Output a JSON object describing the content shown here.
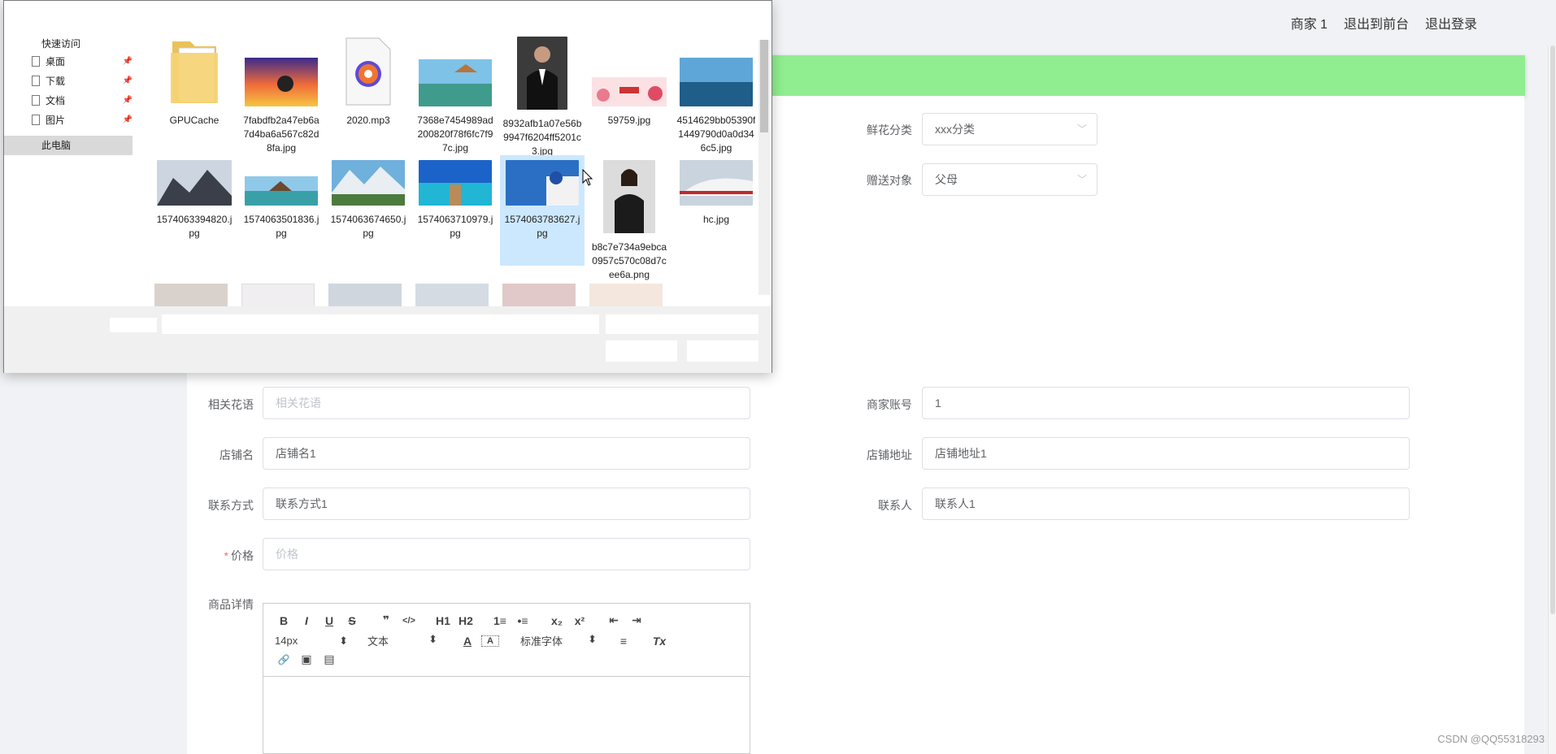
{
  "header": {
    "merchant": "商家 1",
    "to_front": "退出到前台",
    "logout": "退出登录"
  },
  "form": {
    "category": {
      "label": "鲜花分类",
      "value": "xxx分类"
    },
    "recipient": {
      "label": "赠送对象",
      "value": "父母"
    },
    "flower_language": {
      "label": "相关花语",
      "placeholder": "相关花语"
    },
    "merchant_account": {
      "label": "商家账号",
      "value": "1"
    },
    "shop_name": {
      "label": "店铺名",
      "value": "店铺名1"
    },
    "shop_address": {
      "label": "店铺地址",
      "value": "店铺地址1"
    },
    "contact_method": {
      "label": "联系方式",
      "value": "联系方式1"
    },
    "contact_person": {
      "label": "联系人",
      "value": "联系人1"
    },
    "price": {
      "required": "*",
      "label": "价格",
      "placeholder": "价格"
    },
    "details": {
      "label": "商品详情"
    }
  },
  "editor": {
    "buttons_row1": [
      "B",
      "I",
      "U",
      "S",
      "❞",
      "</>",
      "H1",
      "H2",
      "1≡",
      "•≡",
      "x₂",
      "x²",
      "⇤",
      "⇥"
    ],
    "font_size": "14px",
    "header_type": "文本",
    "font_family": "标准字体",
    "picker_arrow": "⬍",
    "color_btn": "A",
    "bg_btn": "A",
    "align_btn": "≡",
    "clean_btn": "Tx",
    "buttons_row3": [
      "🔗",
      "▣",
      "▤"
    ]
  },
  "dialog": {
    "quick_access": "快速访问",
    "sidebar": [
      {
        "label": "桌面",
        "pinned": true
      },
      {
        "label": "下载",
        "pinned": true
      },
      {
        "label": "文档",
        "pinned": true
      },
      {
        "label": "图片",
        "pinned": true
      }
    ],
    "pin_glyph": "📌",
    "this_pc": "此电脑",
    "files": [
      {
        "name": "GPUCache",
        "icon": "folder-icon"
      },
      {
        "name": "7fabdfb2a47eb6a7d4ba6a567c82d8fa.jpg",
        "icon": "sunset-image"
      },
      {
        "name": "2020.mp3",
        "icon": "audio-file-icon"
      },
      {
        "name": "7368e7454989ad200820f78f6fc7f97c.jpg",
        "icon": "resort-image"
      },
      {
        "name": "8932afb1a07e56b9947f6204ff5201c3.jpg",
        "icon": "portrait-image"
      },
      {
        "name": "59759.jpg",
        "icon": "banner-image"
      },
      {
        "name": "4514629bb05390f1449790d0a0d346c5.jpg",
        "icon": "lake-image"
      },
      {
        "name": "1574063394820.jpg",
        "icon": "mountain-image"
      },
      {
        "name": "1574063501836.jpg",
        "icon": "beach-house-image"
      },
      {
        "name": "1574063674650.jpg",
        "icon": "alpine-image"
      },
      {
        "name": "1574063710979.jpg",
        "icon": "pier-image"
      },
      {
        "name": "1574063783627.jpg",
        "icon": "santorini-image",
        "selected": true
      },
      {
        "name": "b8c7e734a9ebca0957c570c08d7cee6a.png",
        "icon": "woman-portrait-image"
      },
      {
        "name": "hc.jpg",
        "icon": "train-image"
      }
    ]
  },
  "watermark": "CSDN @QQ55318293"
}
